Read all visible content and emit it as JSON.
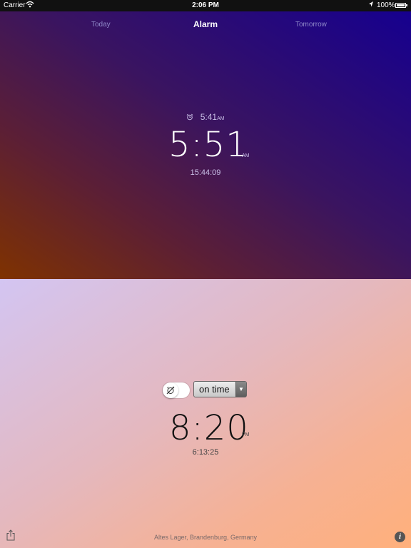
{
  "status_bar": {
    "carrier": "Carrier",
    "time": "2:06 PM",
    "battery": "100%"
  },
  "tabs": {
    "today": "Today",
    "alarm": "Alarm",
    "tomorrow": "Tomorrow"
  },
  "top": {
    "alarm_time": "5:41",
    "alarm_ampm": "AM",
    "time": "5:51",
    "ampm": "AM",
    "countdown": "15:44:09"
  },
  "bottom": {
    "mode": "on time",
    "time": "8:20",
    "ampm": "PM",
    "countdown": "6:13:25"
  },
  "footer": {
    "location": "Altes Lager, Brandenburg, Germany"
  },
  "colors": {
    "top_gradient": [
      "#16008f",
      "#3a1460",
      "#5c1f35",
      "#7f3200"
    ],
    "bottom_gradient": [
      "#d3c5f2",
      "#e4b8bf",
      "#f6b193",
      "#ffb07b"
    ]
  },
  "icons": [
    "wifi-icon",
    "location-arrow-icon",
    "battery-icon",
    "alarm-clock-icon",
    "alarm-off-icon",
    "dropdown-arrow-icon",
    "share-icon",
    "info-icon"
  ]
}
